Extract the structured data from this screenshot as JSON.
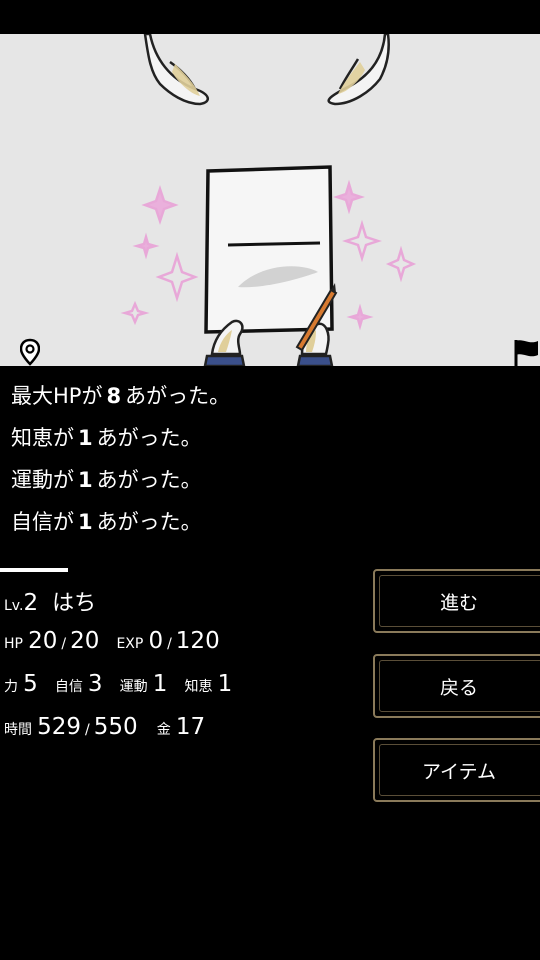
{
  "log": [
    {
      "prefix": "最大HPが",
      "value": "8",
      "suffix": "あがった。"
    },
    {
      "prefix": "知恵が",
      "value": "1",
      "suffix": "あがった。"
    },
    {
      "prefix": "運動が",
      "value": "1",
      "suffix": "あがった。"
    },
    {
      "prefix": "自信が",
      "value": "1",
      "suffix": "あがった。"
    }
  ],
  "status": {
    "lv_label": "Lv.",
    "lv": "2",
    "name": "はち",
    "hp_label": "HP",
    "hp": "20",
    "hp_max": "20",
    "exp_label": "EXP",
    "exp": "0",
    "exp_max": "120",
    "str_label": "力",
    "str": "5",
    "conf_label": "自信",
    "conf": "3",
    "ath_label": "運動",
    "ath": "1",
    "wis_label": "知恵",
    "wis": "1",
    "time_label": "時間",
    "time": "529",
    "time_max": "550",
    "gold_label": "金",
    "gold": "17",
    "slash": "/"
  },
  "buttons": {
    "forward": "進む",
    "back": "戻る",
    "items": "アイテム"
  },
  "icons": {
    "location": "map-pin-icon",
    "goal": "flag-icon"
  },
  "colors": {
    "scene_bg": "#e6e6e6",
    "sparkle": "#e8a8d8",
    "button_border": "#8a7a5a"
  }
}
